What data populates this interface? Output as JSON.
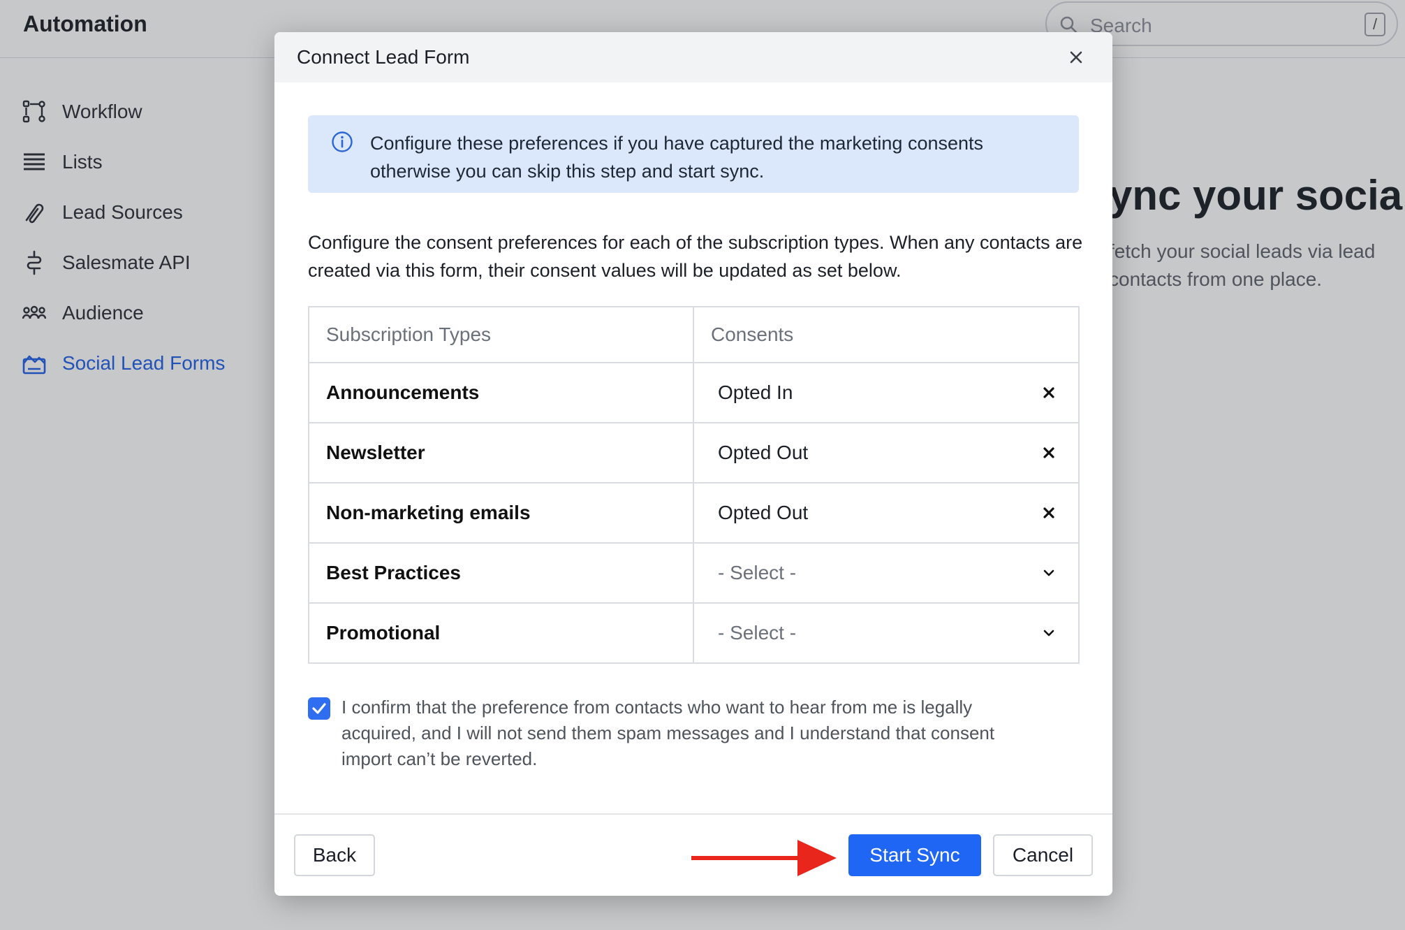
{
  "app": {
    "title": "Automation",
    "search_placeholder": "Search",
    "search_shortcut": "/"
  },
  "sidebar": {
    "items": [
      {
        "label": "Workflow",
        "icon": "workflow-icon"
      },
      {
        "label": "Lists",
        "icon": "list-icon"
      },
      {
        "label": "Lead Sources",
        "icon": "link-icon"
      },
      {
        "label": "Salesmate API",
        "icon": "api-icon"
      },
      {
        "label": "Audience",
        "icon": "audience-icon"
      },
      {
        "label": "Social Lead Forms",
        "icon": "form-icon",
        "active": true
      }
    ]
  },
  "background": {
    "hero_title": "ync your social",
    "hero_sub_1": "fetch your social leads via lead",
    "hero_sub_2": "contacts from one place."
  },
  "modal": {
    "title": "Connect Lead Form",
    "info_text": "Configure these preferences if you have captured the marketing consents otherwise you can skip this step and start sync.",
    "description": "Configure the consent preferences for each of the subscription types. When any contacts are created via this form, their consent values will be updated as set below.",
    "table": {
      "headers": [
        "Subscription Types",
        "Consents"
      ],
      "rows": [
        {
          "type": "Announcements",
          "consent": "Opted In",
          "control": "clear"
        },
        {
          "type": "Newsletter",
          "consent": "Opted Out",
          "control": "clear"
        },
        {
          "type": "Non-marketing emails",
          "consent": "Opted Out",
          "control": "clear"
        },
        {
          "type": "Best Practices",
          "consent": "- Select -",
          "control": "dropdown"
        },
        {
          "type": "Promotional",
          "consent": "- Select -",
          "control": "dropdown"
        }
      ]
    },
    "confirm_checked": true,
    "confirm_text": "I confirm that the preference from contacts who want to hear from me is legally acquired, and I will not send them spam messages and I understand that consent import can’t be reverted.",
    "buttons": {
      "back": "Back",
      "start_sync": "Start Sync",
      "cancel": "Cancel"
    }
  },
  "colors": {
    "accent": "#1f66f5",
    "info_bg": "#dbe8fb",
    "annotation_arrow": "#e8261c"
  }
}
